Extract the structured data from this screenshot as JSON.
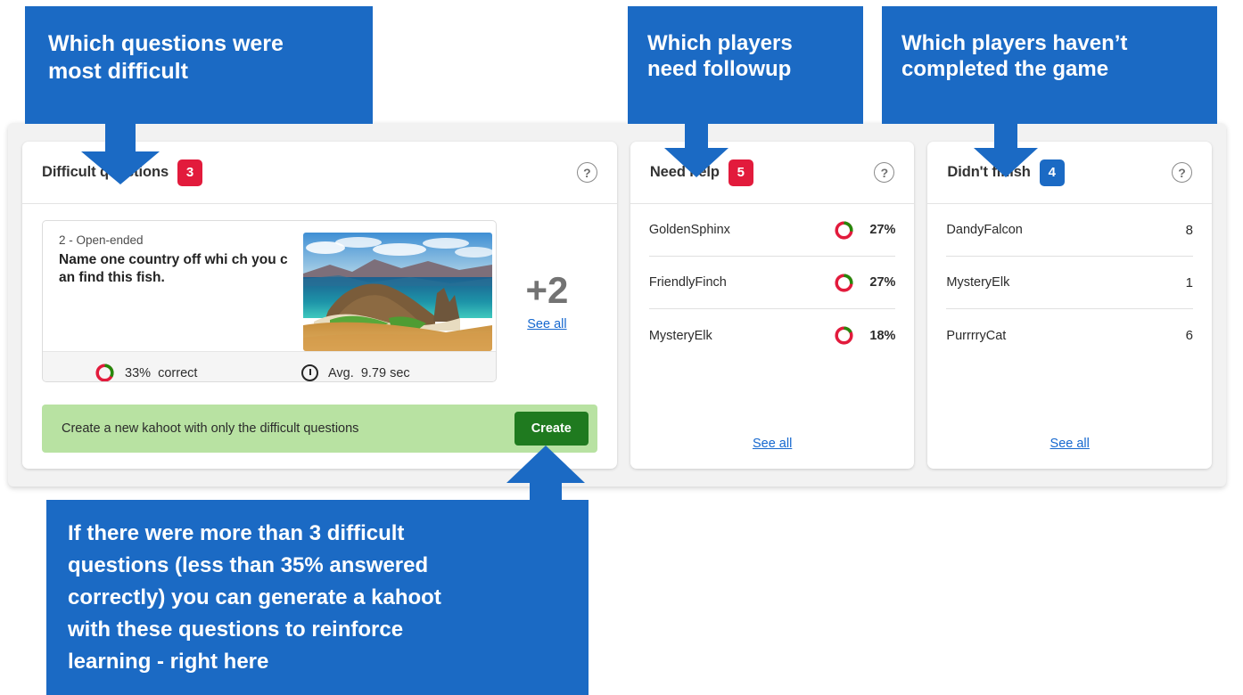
{
  "colors": {
    "annotation_blue": "#1b6ac4",
    "badge_red": "#e21b3c",
    "badge_blue": "#1b6ac4",
    "cta_green_bg": "#b8e2a2",
    "cta_button_green": "#1f7a1f",
    "link_blue": "#1668cf",
    "donut_correct": "#26890c",
    "donut_incorrect": "#e21b3c",
    "panel_bg": "#f2f2f2"
  },
  "annotations": [
    {
      "id": "difficult-questions",
      "lines": [
        "Which questions were",
        "most difficult"
      ]
    },
    {
      "id": "need-followup",
      "lines": [
        "Which players",
        "need followup"
      ]
    },
    {
      "id": "not-completed",
      "lines": [
        "Which players haven’t",
        "completed the game"
      ]
    },
    {
      "id": "create-kahoot",
      "lines": [
        "If there were more than 3 difficult",
        "questions (less than 35% answered",
        "correctly) you can generate a kahoot",
        "with these questions to reinforce",
        "learning - right here"
      ]
    }
  ],
  "difficult_questions": {
    "title": "Difficult questions",
    "badge": "3",
    "help_icon": "question-mark-circle-icon",
    "question": {
      "meta": "2 - Open-ended",
      "text": "Name one country off whi ch you can find this fish.",
      "image_alt": "galapagos-island-landscape",
      "correct_label": "correct",
      "correct_percent": "33%",
      "correct_value": 33,
      "time_label": "Avg.",
      "time_value": "9.79 sec"
    },
    "more_count": "+2",
    "see_all": "See all",
    "cta": {
      "text": "Create a new kahoot with only the difficult questions",
      "button": "Create"
    }
  },
  "need_help": {
    "title": "Need help",
    "badge": "5",
    "help_icon": "question-mark-circle-icon",
    "rows": [
      {
        "name": "GoldenSphinx",
        "percent": "27%",
        "value": 27
      },
      {
        "name": "FriendlyFinch",
        "percent": "27%",
        "value": 27
      },
      {
        "name": "MysteryElk",
        "percent": "18%",
        "value": 18
      }
    ],
    "see_all": "See all"
  },
  "didnt_finish": {
    "title": "Didn't finish",
    "badge": "4",
    "help_icon": "question-mark-circle-icon",
    "rows": [
      {
        "name": "DandyFalcon",
        "count": "8"
      },
      {
        "name": "MysteryElk",
        "count": "1"
      },
      {
        "name": "PurrrryCat",
        "count": "6"
      }
    ],
    "see_all": "See all"
  }
}
